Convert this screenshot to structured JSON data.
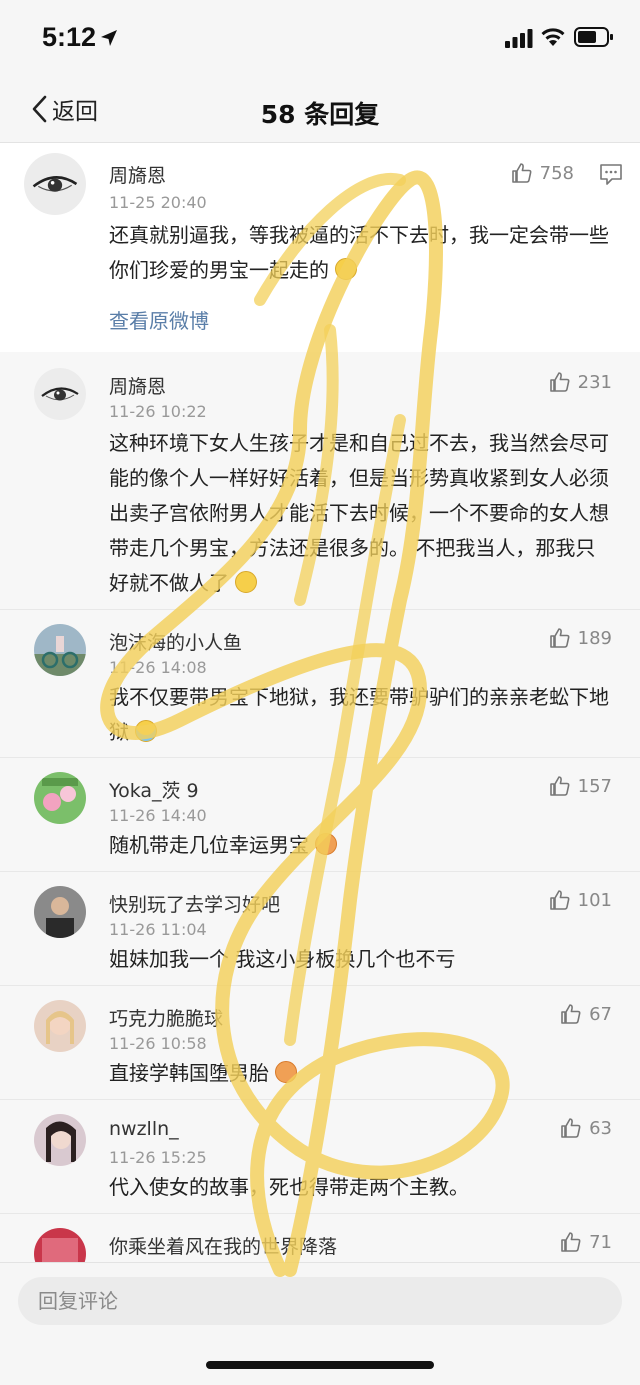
{
  "status_bar": {
    "time": "5:12"
  },
  "nav": {
    "back_label": "返回",
    "title": "58 条回复"
  },
  "original": {
    "name": "周旖恩",
    "time": "11-25 20:40",
    "text": "还真就别逼我，等我被逼的活不下去时，我一定会带一些你们珍爱的男宝一起走的",
    "likes": "758",
    "view_original": "查看原微博"
  },
  "comments": [
    {
      "name": "周旖恩",
      "time": "11-26 10:22",
      "likes": "231",
      "text": "这种环境下女人生孩子才是和自己过不去，我当然会尽可能的像个人一样好好活着，但是当形势真收紧到女人必须出卖子宫依附男人才能活下去时候，一个不要命的女人想带走几个男宝，方法还是很多的。 不把我当人，那我只好就不做人了"
    },
    {
      "name": "泡沫海的小人鱼",
      "time": "11-26 14:08",
      "likes": "189",
      "text": "我不仅要带男宝下地狱，我还要带驴驴们的亲亲老蚣下地狱"
    },
    {
      "name": "Yoka_茨 9",
      "time": "11-26 14:40",
      "likes": "157",
      "text": "随机带走几位幸运男宝"
    },
    {
      "name": "快别玩了去学习好吧",
      "time": "11-26 11:04",
      "likes": "101",
      "text": "姐妹加我一个 我这小身板换几个也不亏"
    },
    {
      "name": "巧克力脆脆球",
      "time": "11-26 10:58",
      "likes": "67",
      "text": "直接学韩国堕男胎"
    },
    {
      "name": "nwzlln_",
      "time": "11-26 15:25",
      "likes": "63",
      "text": "代入使女的故事，死也得带走两个主教。"
    },
    {
      "name": "你乘坐着风在我的世界降落",
      "time": "",
      "likes": "71",
      "text": ""
    }
  ],
  "reply_bar": {
    "placeholder": "回复评论"
  },
  "colors": {
    "link": "#5a7ea8",
    "scribble": "#f3d05a"
  }
}
